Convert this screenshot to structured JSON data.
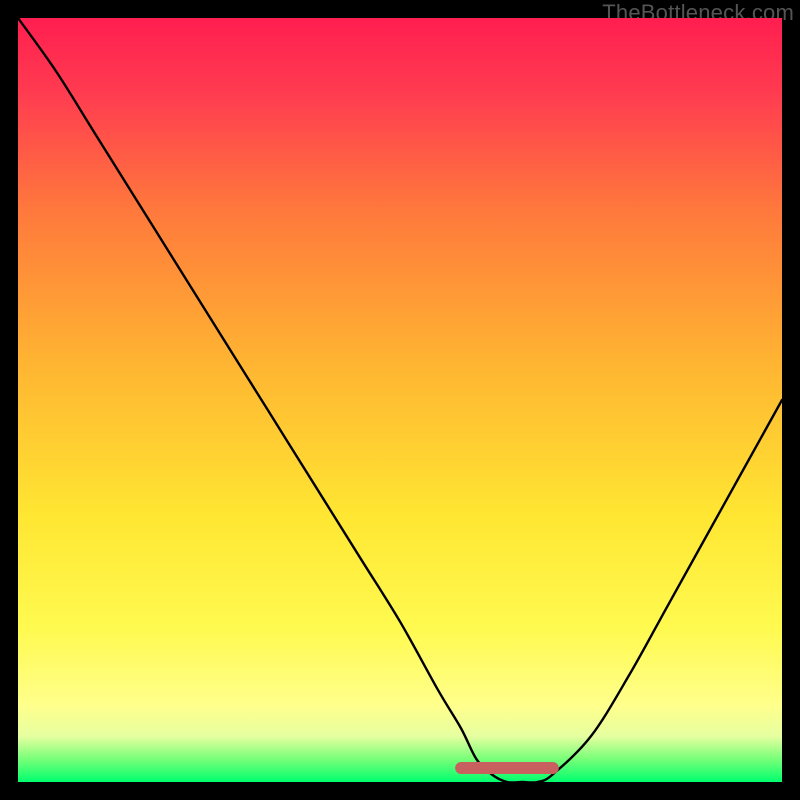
{
  "watermark": "TheBottleneck.com",
  "chart_data": {
    "type": "line",
    "title": "",
    "xlabel": "",
    "ylabel": "",
    "xlim": [
      0,
      100
    ],
    "ylim": [
      0,
      100
    ],
    "series": [
      {
        "name": "bottleneck-curve",
        "x": [
          0,
          5,
          10,
          15,
          20,
          25,
          30,
          35,
          40,
          45,
          50,
          55,
          58,
          60,
          62,
          64,
          66,
          68,
          70,
          75,
          80,
          85,
          90,
          95,
          100
        ],
        "values": [
          100,
          93,
          85,
          77,
          69,
          61,
          53,
          45,
          37,
          29,
          21,
          12,
          7,
          3,
          1,
          0,
          0,
          0,
          1,
          6,
          14,
          23,
          32,
          41,
          50
        ]
      },
      {
        "name": "target-segment",
        "x": [
          58,
          70
        ],
        "values": [
          0,
          0
        ]
      }
    ],
    "gradient_stops": [
      {
        "pos": 0,
        "color": "#00ff6e"
      },
      {
        "pos": 10,
        "color": "#ffff8c"
      },
      {
        "pos": 35,
        "color": "#ffe632"
      },
      {
        "pos": 55,
        "color": "#ffb432"
      },
      {
        "pos": 75,
        "color": "#ff783c"
      },
      {
        "pos": 100,
        "color": "#ff1e50"
      }
    ]
  }
}
